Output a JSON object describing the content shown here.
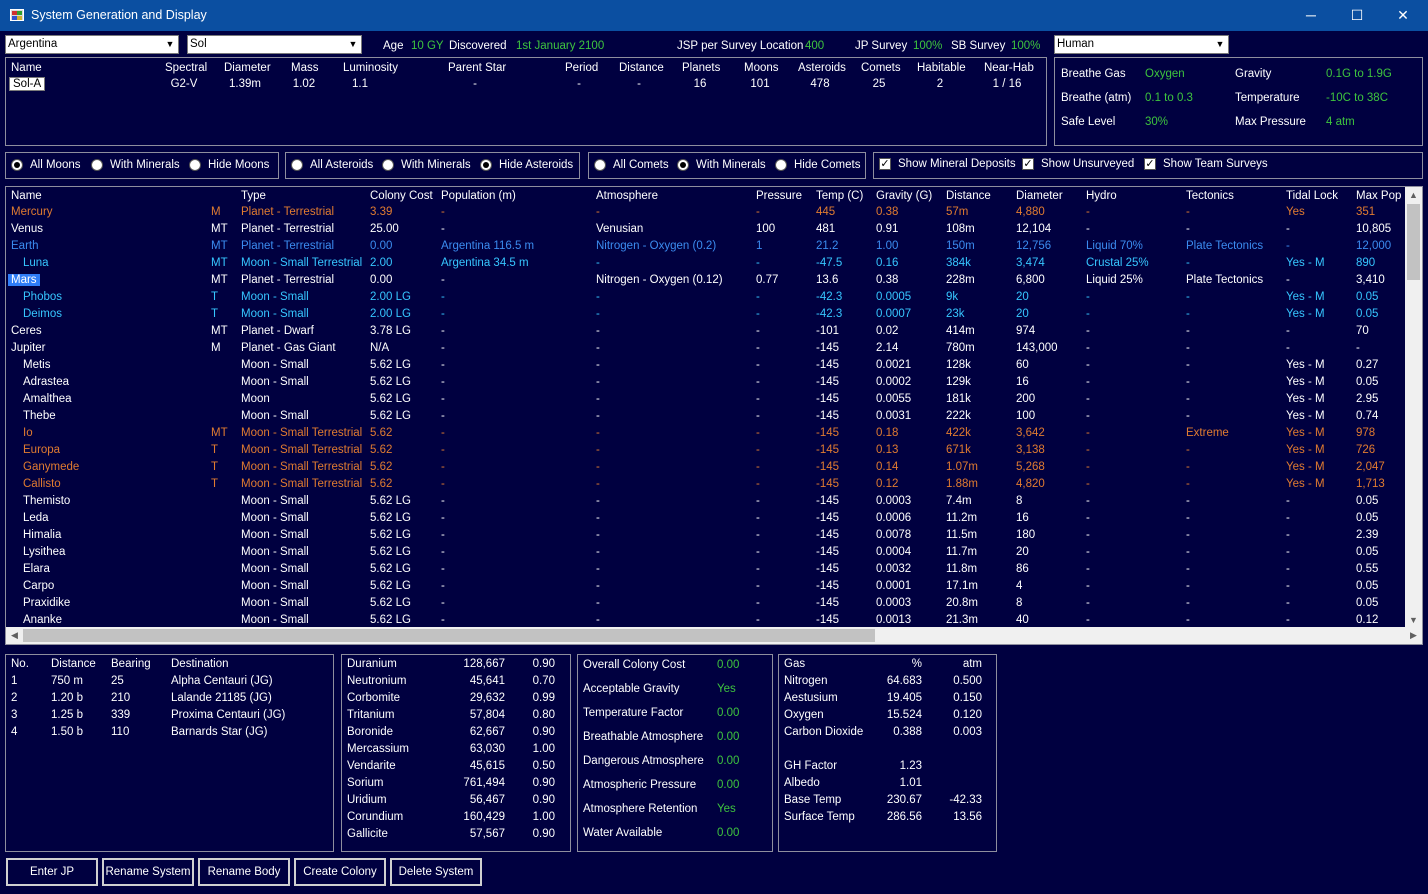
{
  "window": {
    "title": "System Generation and Display",
    "minimize": "─",
    "maximize": "☐",
    "close": "✕"
  },
  "top": {
    "race": "Argentina",
    "system": "Sol",
    "age_label": "Age",
    "age_value": "10 GY",
    "discovered_label": "Discovered",
    "discovered_value": "1st January 2100",
    "jsp_label": "JSP per Survey Location",
    "jsp_value": "400",
    "jp_label": "JP Survey",
    "jp_value": "100%",
    "sb_label": "SB Survey",
    "sb_value": "100%",
    "species": "Human"
  },
  "star": {
    "headers": [
      "Name",
      "Spectral",
      "Diameter",
      "Mass",
      "Luminosity",
      "Parent Star",
      "Period",
      "Distance",
      "Planets",
      "Moons",
      "Asteroids",
      "Comets",
      "Habitable",
      "Near-Hab"
    ],
    "values": [
      "Sol-A",
      "G2-V",
      "1.39m",
      "1.02",
      "1.1",
      "-",
      "-",
      "-",
      "16",
      "101",
      "478",
      "25",
      "2",
      "1 / 16"
    ]
  },
  "species_panel": {
    "breathe_gas_label": "Breathe Gas",
    "breathe_gas": "Oxygen",
    "gravity_label": "Gravity",
    "gravity": "0.1G  to  1.9G",
    "breathe_atm_label": "Breathe (atm)",
    "breathe_atm": "0.1  to  0.3",
    "temperature_label": "Temperature",
    "temperature": "-10C  to  38C",
    "safe_level_label": "Safe Level",
    "safe_level": "30%",
    "max_pressure_label": "Max Pressure",
    "max_pressure": "4 atm"
  },
  "filters": {
    "moons": [
      "All Moons",
      "With Minerals",
      "Hide Moons"
    ],
    "asteroids": [
      "All Asteroids",
      "With Minerals",
      "Hide Asteroids"
    ],
    "comets": [
      "All Comets",
      "With Minerals",
      "Hide Comets"
    ],
    "checks": [
      "Show Mineral Deposits",
      "Show Unsurveyed",
      "Show Team Surveys"
    ]
  },
  "grid": {
    "headers": [
      "Name",
      "Type",
      "Colony Cost",
      "Population (m)",
      "Atmosphere",
      "Pressure",
      "Temp (C)",
      "Gravity (G)",
      "Distance",
      "Diameter",
      "Hydro",
      "Tectonics",
      "Tidal Lock",
      "Max Pop"
    ],
    "rows": [
      {
        "c": "orange",
        "ind": 0,
        "cells": [
          "Mercury",
          "M",
          "Planet - Terrestrial",
          "3.39",
          "-",
          "-",
          "-",
          "445",
          "0.38",
          "57m",
          "4,880",
          "-",
          "-",
          "Yes",
          "351"
        ]
      },
      {
        "c": "white",
        "ind": 0,
        "cells": [
          "Venus",
          "MT",
          "Planet - Terrestrial",
          "25.00",
          "-",
          "Venusian",
          "100",
          "481",
          "0.91",
          "108m",
          "12,104",
          "-",
          "-",
          "-",
          "10,805"
        ]
      },
      {
        "c": "blue",
        "ind": 0,
        "cells": [
          "Earth",
          "MT",
          "Planet - Terrestrial",
          "0.00",
          "Argentina 116.5 m",
          "Nitrogen - Oxygen (0.2)",
          "1",
          "21.2",
          "1.00",
          "150m",
          "12,756",
          "Liquid 70%",
          "Plate Tectonics",
          "-",
          "12,000"
        ]
      },
      {
        "c": "cyan",
        "ind": 1,
        "cells": [
          "Luna",
          "MT",
          "Moon - Small Terrestrial",
          "2.00",
          "Argentina 34.5 m",
          "-",
          "-",
          "-47.5",
          "0.16",
          "384k",
          "3,474",
          "Crustal 25%",
          "-",
          "Yes - M",
          "890"
        ]
      },
      {
        "c": "white",
        "ind": 0,
        "sel": true,
        "cells": [
          "Mars",
          "MT",
          "Planet - Terrestrial",
          "0.00",
          "-",
          "Nitrogen - Oxygen (0.12)",
          "0.77",
          "13.6",
          "0.38",
          "228m",
          "6,800",
          "Liquid 25%",
          "Plate Tectonics",
          "-",
          "3,410"
        ]
      },
      {
        "c": "cyan",
        "ind": 1,
        "cells": [
          "Phobos",
          "T",
          "Moon - Small",
          "2.00 LG",
          "-",
          "-",
          "-",
          "-42.3",
          "0.0005",
          "9k",
          "20",
          "-",
          "-",
          "Yes - M",
          "0.05"
        ]
      },
      {
        "c": "cyan",
        "ind": 1,
        "cells": [
          "Deimos",
          "T",
          "Moon - Small",
          "2.00 LG",
          "-",
          "-",
          "-",
          "-42.3",
          "0.0007",
          "23k",
          "20",
          "-",
          "-",
          "Yes - M",
          "0.05"
        ]
      },
      {
        "c": "white",
        "ind": 0,
        "cells": [
          "Ceres",
          "MT",
          "Planet - Dwarf",
          "3.78 LG",
          "-",
          "-",
          "-",
          "-101",
          "0.02",
          "414m",
          "974",
          "-",
          "-",
          "-",
          "70"
        ]
      },
      {
        "c": "white",
        "ind": 0,
        "cells": [
          "Jupiter",
          "M",
          "Planet - Gas Giant",
          "N/A",
          "-",
          "-",
          "-",
          "-145",
          "2.14",
          "780m",
          "143,000",
          "-",
          "-",
          "-",
          "-"
        ]
      },
      {
        "c": "white",
        "ind": 1,
        "cells": [
          "Metis",
          "",
          "Moon - Small",
          "5.62 LG",
          "-",
          "-",
          "-",
          "-145",
          "0.0021",
          "128k",
          "60",
          "-",
          "-",
          "Yes - M",
          "0.27"
        ]
      },
      {
        "c": "white",
        "ind": 1,
        "cells": [
          "Adrastea",
          "",
          "Moon - Small",
          "5.62 LG",
          "-",
          "-",
          "-",
          "-145",
          "0.0002",
          "129k",
          "16",
          "-",
          "-",
          "Yes - M",
          "0.05"
        ]
      },
      {
        "c": "white",
        "ind": 1,
        "cells": [
          "Amalthea",
          "",
          "Moon",
          "5.62 LG",
          "-",
          "-",
          "-",
          "-145",
          "0.0055",
          "181k",
          "200",
          "-",
          "-",
          "Yes - M",
          "2.95"
        ]
      },
      {
        "c": "white",
        "ind": 1,
        "cells": [
          "Thebe",
          "",
          "Moon - Small",
          "5.62 LG",
          "-",
          "-",
          "-",
          "-145",
          "0.0031",
          "222k",
          "100",
          "-",
          "-",
          "Yes - M",
          "0.74"
        ]
      },
      {
        "c": "orange",
        "ind": 1,
        "cells": [
          "Io",
          "MT",
          "Moon - Small Terrestrial",
          "5.62",
          "-",
          "-",
          "-",
          "-145",
          "0.18",
          "422k",
          "3,642",
          "-",
          "Extreme",
          "Yes - M",
          "978"
        ]
      },
      {
        "c": "orange",
        "ind": 1,
        "cells": [
          "Europa",
          "T",
          "Moon - Small Terrestrial",
          "5.62",
          "-",
          "-",
          "-",
          "-145",
          "0.13",
          "671k",
          "3,138",
          "-",
          "-",
          "Yes - M",
          "726"
        ]
      },
      {
        "c": "orange",
        "ind": 1,
        "cells": [
          "Ganymede",
          "T",
          "Moon - Small Terrestrial",
          "5.62",
          "-",
          "-",
          "-",
          "-145",
          "0.14",
          "1.07m",
          "5,268",
          "-",
          "-",
          "Yes - M",
          "2,047"
        ]
      },
      {
        "c": "orange",
        "ind": 1,
        "cells": [
          "Callisto",
          "T",
          "Moon - Small Terrestrial",
          "5.62",
          "-",
          "-",
          "-",
          "-145",
          "0.12",
          "1.88m",
          "4,820",
          "-",
          "-",
          "Yes - M",
          "1,713"
        ]
      },
      {
        "c": "white",
        "ind": 1,
        "cells": [
          "Themisto",
          "",
          "Moon - Small",
          "5.62 LG",
          "-",
          "-",
          "-",
          "-145",
          "0.0003",
          "7.4m",
          "8",
          "-",
          "-",
          "-",
          "0.05"
        ]
      },
      {
        "c": "white",
        "ind": 1,
        "cells": [
          "Leda",
          "",
          "Moon - Small",
          "5.62 LG",
          "-",
          "-",
          "-",
          "-145",
          "0.0006",
          "11.2m",
          "16",
          "-",
          "-",
          "-",
          "0.05"
        ]
      },
      {
        "c": "white",
        "ind": 1,
        "cells": [
          "Himalia",
          "",
          "Moon - Small",
          "5.62 LG",
          "-",
          "-",
          "-",
          "-145",
          "0.0078",
          "11.5m",
          "180",
          "-",
          "-",
          "-",
          "2.39"
        ]
      },
      {
        "c": "white",
        "ind": 1,
        "cells": [
          "Lysithea",
          "",
          "Moon - Small",
          "5.62 LG",
          "-",
          "-",
          "-",
          "-145",
          "0.0004",
          "11.7m",
          "20",
          "-",
          "-",
          "-",
          "0.05"
        ]
      },
      {
        "c": "white",
        "ind": 1,
        "cells": [
          "Elara",
          "",
          "Moon - Small",
          "5.62 LG",
          "-",
          "-",
          "-",
          "-145",
          "0.0032",
          "11.8m",
          "86",
          "-",
          "-",
          "-",
          "0.55"
        ]
      },
      {
        "c": "white",
        "ind": 1,
        "cells": [
          "Carpo",
          "",
          "Moon - Small",
          "5.62 LG",
          "-",
          "-",
          "-",
          "-145",
          "0.0001",
          "17.1m",
          "4",
          "-",
          "-",
          "-",
          "0.05"
        ]
      },
      {
        "c": "white",
        "ind": 1,
        "cells": [
          "Praxidike",
          "",
          "Moon - Small",
          "5.62 LG",
          "-",
          "-",
          "-",
          "-145",
          "0.0003",
          "20.8m",
          "8",
          "-",
          "-",
          "-",
          "0.05"
        ]
      },
      {
        "c": "white",
        "ind": 1,
        "cells": [
          "Ananke",
          "",
          "Moon - Small",
          "5.62 LG",
          "-",
          "-",
          "-",
          "-145",
          "0.0013",
          "21.3m",
          "40",
          "-",
          "-",
          "-",
          "0.12"
        ]
      }
    ]
  },
  "jump": {
    "headers": [
      "No.",
      "Distance",
      "Bearing",
      "Destination"
    ],
    "rows": [
      [
        "1",
        "750 m",
        "25",
        "Alpha Centauri (JG)"
      ],
      [
        "2",
        "1.20 b",
        "210",
        "Lalande 21185 (JG)"
      ],
      [
        "3",
        "1.25 b",
        "339",
        "Proxima Centauri (JG)"
      ],
      [
        "4",
        "1.50 b",
        "110",
        "Barnards Star (JG)"
      ]
    ]
  },
  "minerals": [
    [
      "Duranium",
      "128,667",
      "0.90"
    ],
    [
      "Neutronium",
      "45,641",
      "0.70"
    ],
    [
      "Corbomite",
      "29,632",
      "0.99"
    ],
    [
      "Tritanium",
      "57,804",
      "0.80"
    ],
    [
      "Boronide",
      "62,667",
      "0.90"
    ],
    [
      "Mercassium",
      "63,030",
      "1.00"
    ],
    [
      "Vendarite",
      "45,615",
      "0.50"
    ],
    [
      "Sorium",
      "761,494",
      "0.90"
    ],
    [
      "Uridium",
      "56,467",
      "0.90"
    ],
    [
      "Corundium",
      "160,429",
      "1.00"
    ],
    [
      "Gallicite",
      "57,567",
      "0.90"
    ]
  ],
  "colony": [
    [
      "Overall Colony Cost",
      "0.00"
    ],
    [
      "Acceptable Gravity",
      "Yes"
    ],
    [
      "Temperature Factor",
      "0.00"
    ],
    [
      "Breathable Atmosphere",
      "0.00"
    ],
    [
      "Dangerous Atmosphere",
      "0.00"
    ],
    [
      "Atmospheric Pressure",
      "0.00"
    ],
    [
      "Atmosphere Retention",
      "Yes"
    ],
    [
      "Water Available",
      "0.00"
    ]
  ],
  "gas": {
    "headers": [
      "Gas",
      "%",
      "atm"
    ],
    "rows": [
      [
        "Nitrogen",
        "64.683",
        "0.500"
      ],
      [
        "Aestusium",
        "19.405",
        "0.150"
      ],
      [
        "Oxygen",
        "15.524",
        "0.120"
      ],
      [
        "Carbon Dioxide",
        "0.388",
        "0.003"
      ]
    ],
    "extra": [
      [
        "GH Factor",
        "1.23",
        ""
      ],
      [
        "Albedo",
        "1.01",
        ""
      ],
      [
        "Base Temp",
        "230.67",
        "-42.33"
      ],
      [
        "Surface Temp",
        "286.56",
        "13.56"
      ]
    ]
  },
  "buttons": [
    "Enter JP",
    "Rename System",
    "Rename Body",
    "Create Colony",
    "Delete System"
  ]
}
